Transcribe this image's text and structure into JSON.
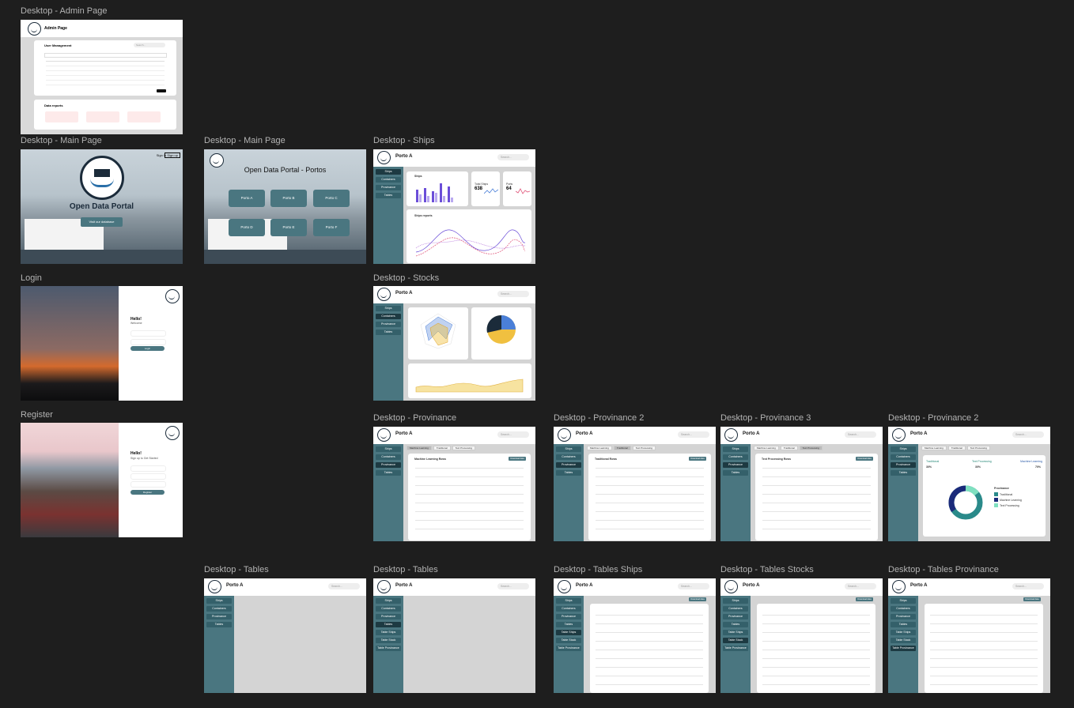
{
  "labels": {
    "admin": "Desktop - Admin Page",
    "main1": "Desktop - Main Page",
    "main2": "Desktop - Main Page",
    "ships": "Desktop - Ships",
    "login": "Login",
    "stocks": "Desktop - Stocks",
    "register": "Register",
    "prov1": "Desktop - Provinance",
    "prov2": "Desktop - Provinance 2",
    "prov3": "Desktop - Provinance 3",
    "prov4": "Desktop - Provinance 2",
    "tables1": "Desktop - Tables",
    "tables2": "Desktop - Tables",
    "tables_ships": "Desktop - Tables Ships",
    "tables_stocks": "Desktop - Tables Stocks",
    "tables_prov": "Desktop - Tables Provinance"
  },
  "admin": {
    "title": "Admin Page",
    "user_mgmt": "User Management",
    "search": "Search...",
    "data_reports": "Data reports"
  },
  "main": {
    "title": "Open Data Portal",
    "button": "Visit our database",
    "sign_in": "Sign in",
    "sign_up": "Sign up",
    "portos_title": "Open Data Portal - Portos",
    "portos": [
      "Porto A",
      "Porto B",
      "Porto C",
      "Porto D",
      "Porto E",
      "Porto F"
    ]
  },
  "app": {
    "porto": "Porto A",
    "search": "Search...",
    "nav": [
      "Ships",
      "Containers",
      "Provinance",
      "Tables"
    ],
    "tables_nav": [
      "Table Ships",
      "Table Stock",
      "Table Provinance"
    ]
  },
  "ships": {
    "ships_card": "Ships",
    "total_ships": "Total Ships",
    "total_ships_value": "638",
    "ports": "Ports",
    "ports_value": "64",
    "ships_reports": "Ships reports"
  },
  "provinance": {
    "tabs": [
      "Machine Learning",
      "Traditional",
      "Text Processing"
    ],
    "ml_title": "Machine Learning Rows",
    "trad_title": "Traditional Rows",
    "text_title": "Text Processing Rows",
    "download": "Download data",
    "legend_title": "Provinance",
    "legend": [
      "Traditional",
      "Machine Learning",
      "Text Processing"
    ],
    "stat_values": [
      "30%",
      "30%",
      "70%"
    ]
  },
  "login": {
    "hello": "Hello!",
    "sub": "Welcome",
    "button": "Login"
  },
  "register": {
    "hello": "Hello!",
    "sub": "Sign up to Get Started",
    "button": "Register"
  },
  "colors": {
    "background": "#1e1e1e",
    "sidebar": "#4a7680",
    "accent": "#4a7680"
  }
}
